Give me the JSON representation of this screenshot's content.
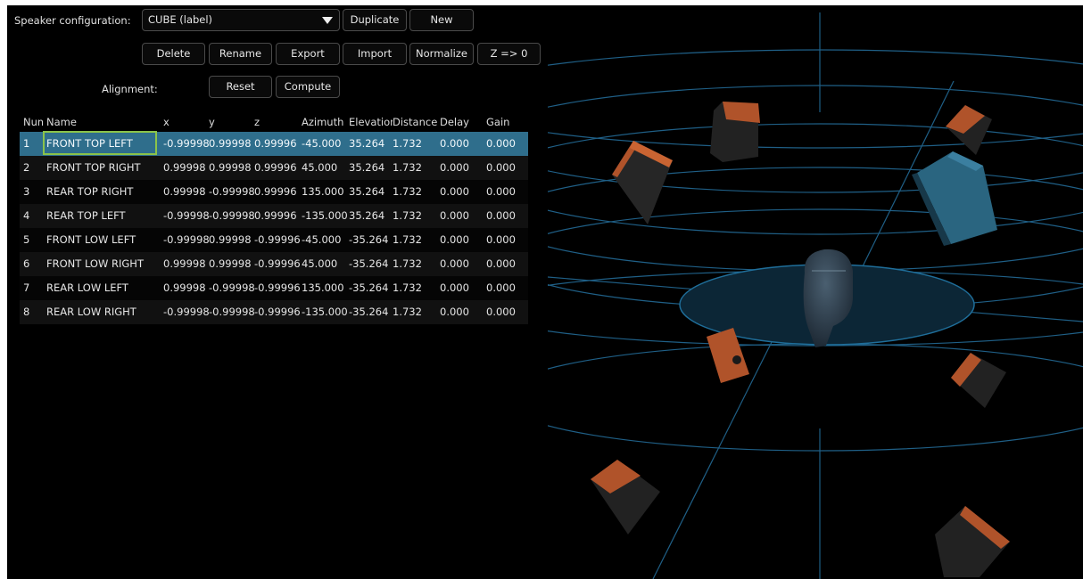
{
  "config": {
    "label": "Speaker configuration:",
    "selected": "CUBE (label)",
    "duplicate": "Duplicate",
    "new": "New"
  },
  "toolbar": {
    "delete": "Delete",
    "rename": "Rename",
    "export": "Export",
    "import": "Import",
    "normalize": "Normalize",
    "z_zero": "Z => 0"
  },
  "alignment": {
    "label": "Alignment:",
    "reset": "Reset",
    "compute": "Compute"
  },
  "table": {
    "headers": [
      "Num",
      "Name",
      "x",
      "y",
      "z",
      "Azimuth",
      "Elevation",
      "Distance",
      "Delay",
      "Gain"
    ],
    "rows": [
      [
        "1",
        "FRONT TOP LEFT",
        "-0.99998",
        "0.99998",
        "0.99996",
        "-45.000",
        "35.264",
        "1.732",
        "0.000",
        "0.000"
      ],
      [
        "2",
        "FRONT TOP RIGHT",
        "0.99998",
        "0.99998",
        "0.99996",
        "45.000",
        "35.264",
        "1.732",
        "0.000",
        "0.000"
      ],
      [
        "3",
        "REAR TOP RIGHT",
        "0.99998",
        "-0.99998",
        "0.99996",
        "135.000",
        "35.264",
        "1.732",
        "0.000",
        "0.000"
      ],
      [
        "4",
        "REAR TOP LEFT",
        "-0.99998",
        "-0.99998",
        "0.99996",
        "-135.000",
        "35.264",
        "1.732",
        "0.000",
        "0.000"
      ],
      [
        "5",
        "FRONT LOW LEFT",
        "-0.99998",
        "0.99998",
        "-0.99996",
        "-45.000",
        "-35.264",
        "1.732",
        "0.000",
        "0.000"
      ],
      [
        "6",
        "FRONT LOW RIGHT",
        "0.99998",
        "0.99998",
        "-0.99996",
        "45.000",
        "-35.264",
        "1.732",
        "0.000",
        "0.000"
      ],
      [
        "7",
        "REAR LOW LEFT",
        "0.99998",
        "-0.99998",
        "-0.99996",
        "135.000",
        "-35.264",
        "1.732",
        "0.000",
        "0.000"
      ],
      [
        "8",
        "REAR LOW RIGHT",
        "-0.99998",
        "-0.99998",
        "-0.99996",
        "-135.000",
        "-35.264",
        "1.732",
        "0.000",
        "0.000"
      ]
    ],
    "selected_row": 1
  },
  "colors": {
    "selection": "#2f6e8c",
    "grid": "#1f5f86",
    "speaker_orange": "#b0532a",
    "speaker_selected": "#2f6e8c"
  }
}
